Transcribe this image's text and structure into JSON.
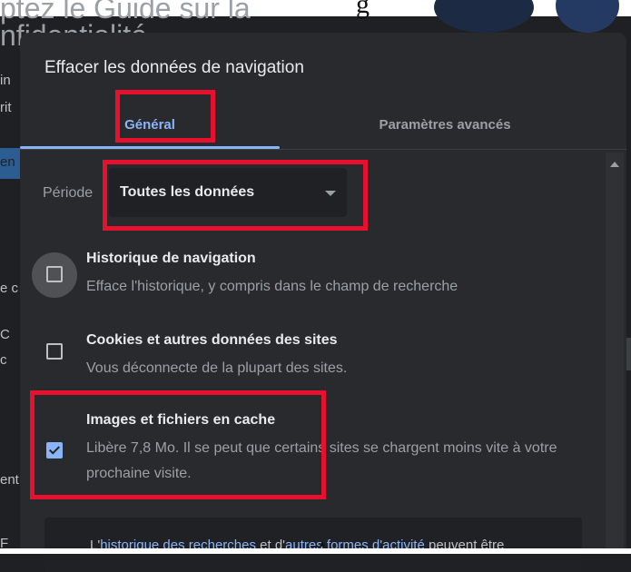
{
  "background": {
    "heading_line1": "ptez le Guide sur la",
    "heading_line2": "nfidentialité",
    "serif_fragment": "g",
    "left_fragments": [
      "in",
      "rit",
      "en",
      "e c",
      "C",
      "c",
      "ent",
      "F"
    ]
  },
  "dialog": {
    "title": "Effacer les données de navigation",
    "tabs": [
      {
        "label": "Général",
        "active": true
      },
      {
        "label": "Paramètres avancés",
        "active": false
      }
    ],
    "period": {
      "label": "Période",
      "selected": "Toutes les données"
    },
    "items": [
      {
        "title": "Historique de navigation",
        "description": "Efface l'historique, y compris dans le champ de recherche",
        "checked": false,
        "focused": true
      },
      {
        "title": "Cookies et autres données des sites",
        "description": "Vous déconnecte de la plupart des sites.",
        "checked": false,
        "focused": false
      },
      {
        "title": "Images et fichiers en cache",
        "description": "Libère 7,8 Mo. Il se peut que certains sites se chargent moins vite à votre prochaine visite.",
        "checked": true,
        "focused": false
      }
    ],
    "note": {
      "prefix": "L'",
      "link1": "historique des recherches",
      "middle": " et d'",
      "link2": "autres formes d'activité",
      "suffix": " peuvent être"
    }
  },
  "colors": {
    "accent": "#8ab4f8",
    "dialog_bg": "#292a2d",
    "annotation": "#e8112d"
  }
}
